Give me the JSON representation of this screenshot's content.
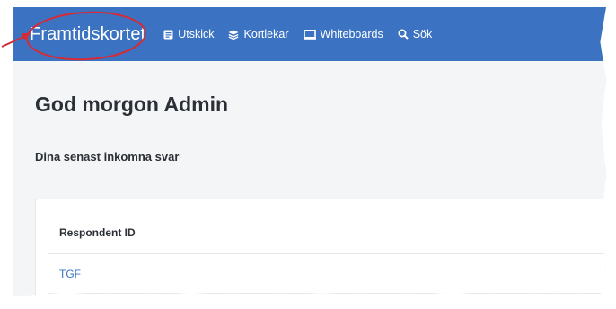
{
  "navbar": {
    "brand": "Framtidskortet",
    "items": [
      {
        "label": "Utskick",
        "icon": "document-icon"
      },
      {
        "label": "Kortlekar",
        "icon": "layers-icon"
      },
      {
        "label": "Whiteboards",
        "icon": "whiteboard-icon"
      },
      {
        "label": "Sök",
        "icon": "search-icon"
      }
    ]
  },
  "main": {
    "greeting": "God morgon Admin",
    "section_title": "Dina senast inkomna svar",
    "table": {
      "columns": [
        "Respondent ID"
      ],
      "rows": [
        [
          "TGF"
        ]
      ]
    }
  },
  "colors": {
    "navbar_bg": "#3b73c2",
    "link": "#3b73c2",
    "annotation": "#d42b36"
  }
}
